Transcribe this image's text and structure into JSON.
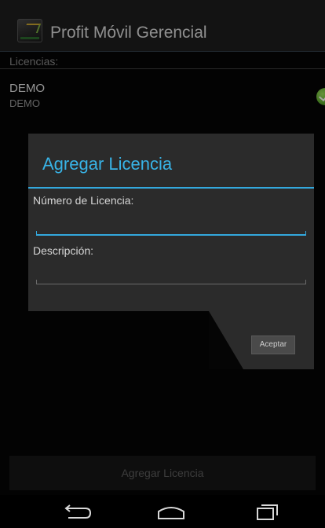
{
  "app": {
    "title": "Profit Móvil Gerencial",
    "icon": "app-logo-icon"
  },
  "section": {
    "header": "Licencias:"
  },
  "licenses": [
    {
      "name": "DEMO",
      "description": "DEMO",
      "status_icon": "check-circle-icon",
      "status_color": "#5aa82a"
    }
  ],
  "dialog": {
    "title": "Agregar Licencia",
    "fields": [
      {
        "label": "Número de Licencia:",
        "value": "",
        "placeholder": ""
      },
      {
        "label": "Descripción:",
        "value": "",
        "placeholder": ""
      }
    ],
    "accept_label": "Aceptar",
    "accent_color": "#33a8dd"
  },
  "footer": {
    "add_button_label": "Agregar Licencia"
  },
  "nav": {
    "back_icon": "back-icon",
    "home_icon": "home-icon",
    "recents_icon": "recents-icon"
  }
}
